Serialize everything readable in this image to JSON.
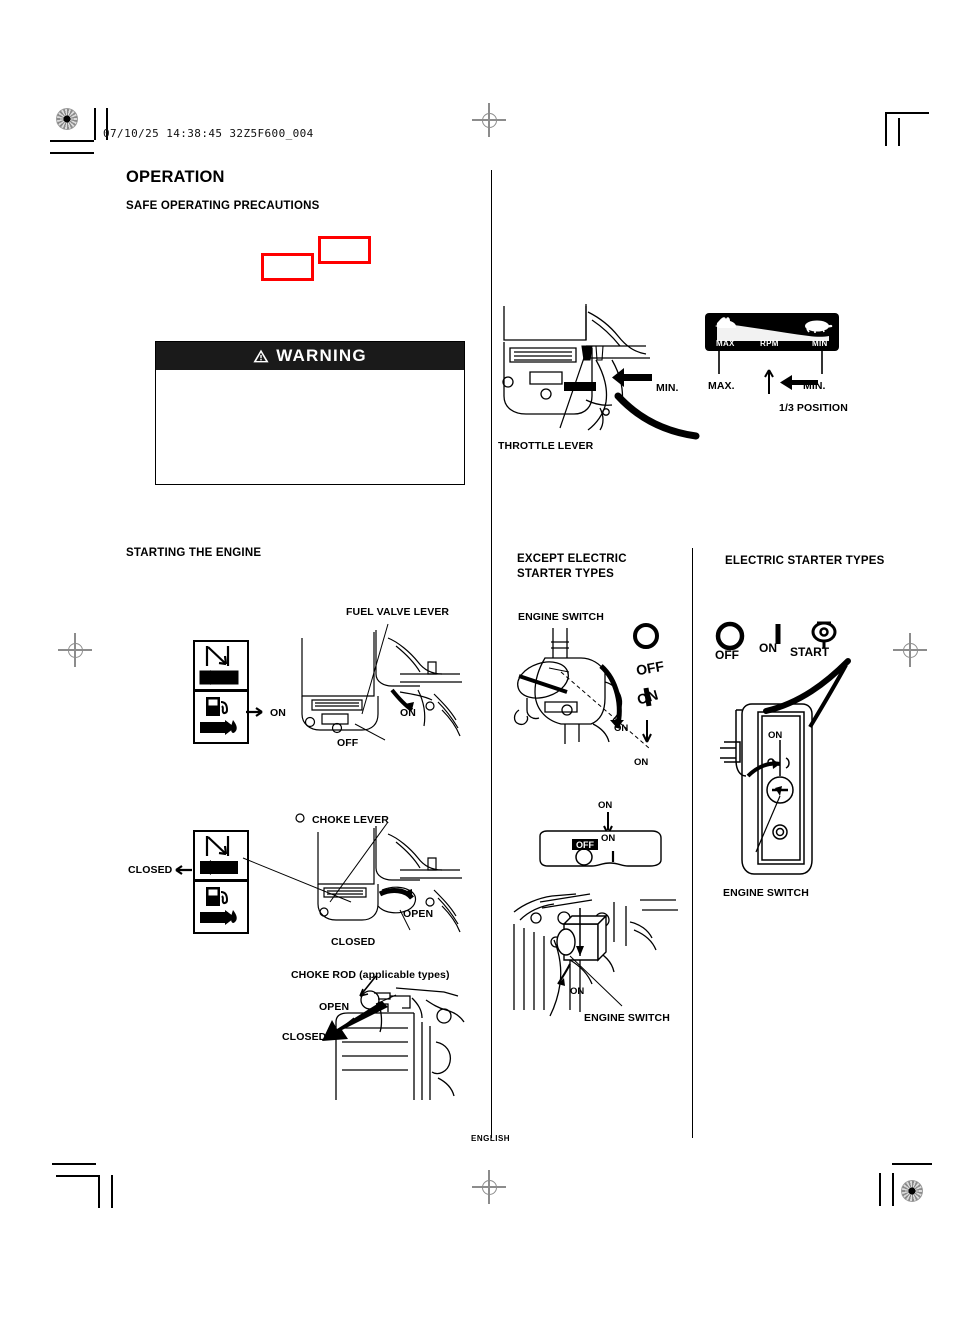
{
  "page": {
    "slug": "07/10/25 14:38:45 32Z5F600_004",
    "footer": "ENGLISH",
    "accent_red": "#ff0000",
    "ink": "#000000"
  },
  "section": {
    "title": "OPERATION",
    "subtitle": "SAFE OPERATING PRECAUTIONS",
    "starting_title": "STARTING THE ENGINE"
  },
  "warning": {
    "label": "WARNING",
    "icon": "warning-triangle-icon",
    "body": ""
  },
  "throttle": {
    "callout": "THROTTLE LEVER",
    "min_on_engine": "MIN.",
    "decal": {
      "max": "MAX",
      "rpm": "RPM",
      "min": "MIN",
      "max_icon": "rabbit-icon",
      "min_icon": "turtle-icon"
    },
    "max_label": "MAX.",
    "min_label": "MIN.",
    "position_label": "1/3 POSITION"
  },
  "fuel_valve": {
    "callout": "FUEL VALVE LEVER",
    "on": "ON",
    "off": "OFF",
    "decal_on": "ON"
  },
  "choke": {
    "callout": "CHOKE LEVER",
    "closed_decal": "CLOSED",
    "open": "OPEN",
    "closed": "CLOSED"
  },
  "choke_rod": {
    "callout": "CHOKE ROD (applicable types)",
    "open": "OPEN",
    "closed": "CLOSED"
  },
  "columns": {
    "except_electric": "EXCEPT ELECTRIC\nSTARTER TYPES",
    "except_electric_line1": "EXCEPT ELECTRIC",
    "except_electric_line2": "STARTER TYPES",
    "electric": "ELECTRIC STARTER TYPES"
  },
  "engine_switch_rotary": {
    "callout": "ENGINE SWITCH",
    "arrow_on": "ON",
    "off_symbol_label": "OFF",
    "on_symbol_label": "ON",
    "bottom_on": "ON"
  },
  "engine_switch_rocker": {
    "callout": "ENGINE SWITCH",
    "top_on": "ON",
    "panel_on": "ON",
    "panel_off": "OFF",
    "bottom_on": "ON"
  },
  "engine_switch_key": {
    "callout": "ENGINE SWITCH",
    "off": "OFF",
    "on": "ON",
    "start": "START",
    "arrow_on": "ON",
    "off_icon": "circle-icon",
    "on_icon": "bar-icon",
    "start_icon": "key-icon"
  }
}
